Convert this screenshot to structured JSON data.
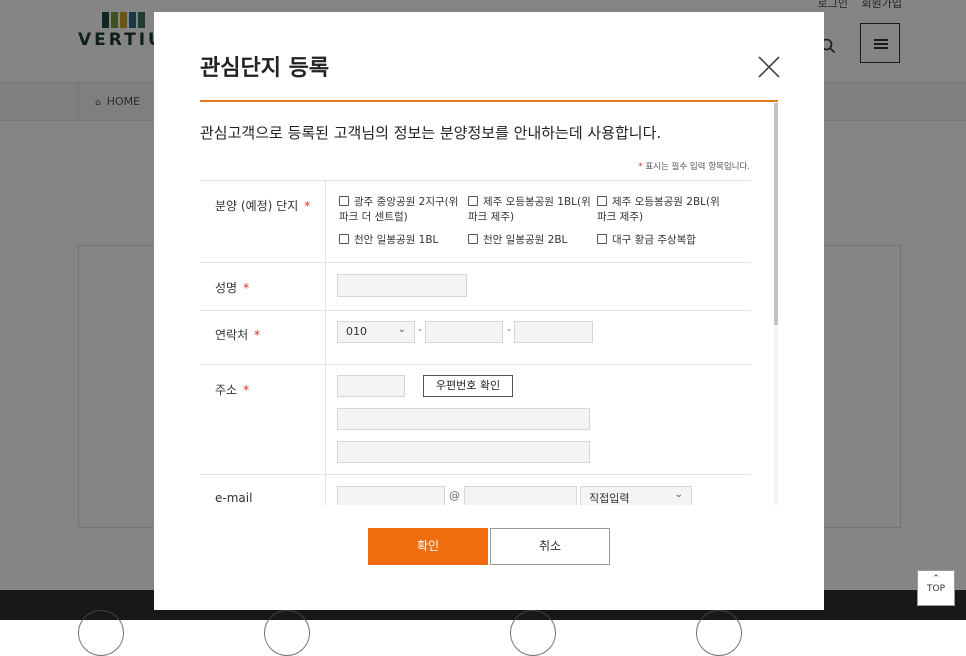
{
  "background": {
    "logo_text": "VERTIUM",
    "logo_colors": [
      "#1f4a3e",
      "#7a9a3a",
      "#c9a227",
      "#2e6e8e",
      "#3a7a5a"
    ],
    "top_links": [
      "로그인",
      "회원가입"
    ],
    "breadcrumb_home": "HOME",
    "top_button": "TOP"
  },
  "modal": {
    "title": "관심단지 등록",
    "intro": "관심고객으로 등록된 고객님의 정보는 분양정보를 안내하는데 사용합니다.",
    "required_note": "표시는 필수 입력 항목입니다.",
    "required_mark": "*",
    "fields": {
      "complex": {
        "label": "분양 (예정) 단지",
        "options": [
          "광주 중앙공원 2지구(위파크 더 센트럴)",
          "제주 오등봉공원 1BL(위파크 제주)",
          "제주 오등봉공원 2BL(위파크 제주)",
          "천안 일봉공원 1BL",
          "천안 일봉공원 2BL",
          "대구 황금 주상복합"
        ]
      },
      "name": {
        "label": "성명"
      },
      "phone": {
        "label": "연락처",
        "prefix": "010",
        "separator": "-"
      },
      "address": {
        "label": "주소",
        "zip_button": "우편번호 확인"
      },
      "email": {
        "label": "e-mail",
        "at": "@",
        "domain_select": "직접입력"
      }
    },
    "buttons": {
      "confirm": "확인",
      "cancel": "취소"
    },
    "accent_color": "#f06d0f"
  }
}
